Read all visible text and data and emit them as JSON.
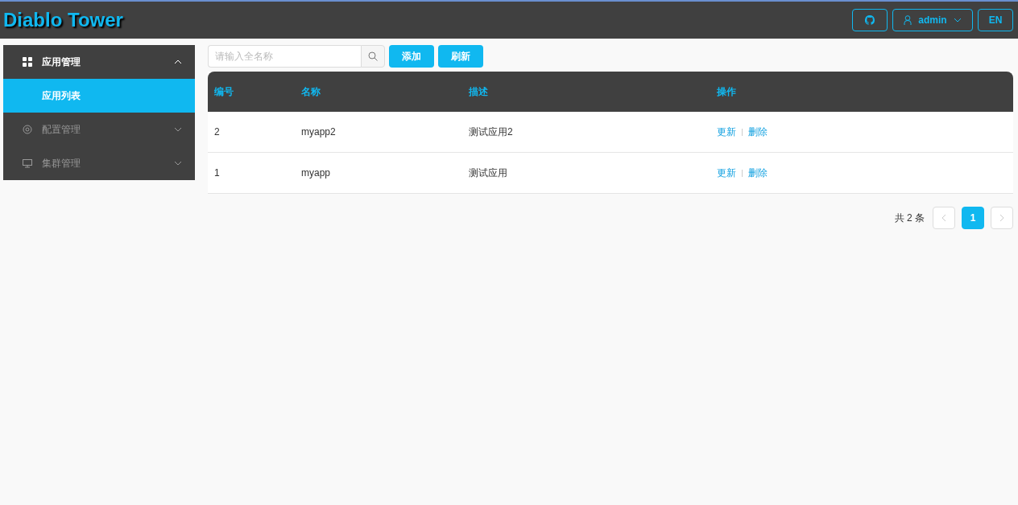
{
  "header": {
    "title": "Diablo Tower",
    "user": "admin",
    "language": "EN"
  },
  "sidebar": {
    "items": [
      {
        "label": "应用管理",
        "expanded": true,
        "children": [
          {
            "label": "应用列表",
            "selected": true
          }
        ]
      },
      {
        "label": "配置管理",
        "expanded": false
      },
      {
        "label": "集群管理",
        "expanded": false
      }
    ]
  },
  "toolbar": {
    "search": {
      "placeholder": "请输入全名称"
    },
    "buttons": [
      "添加",
      "刷新"
    ]
  },
  "table": {
    "columns": [
      "编号",
      "名称",
      "描述",
      "操作"
    ],
    "rows": [
      {
        "cells": [
          "2",
          "myapp2",
          "测试应用2"
        ],
        "actions": [
          "更新",
          "删除"
        ]
      },
      {
        "cells": [
          "1",
          "myapp",
          "测试应用"
        ],
        "actions": [
          "更新",
          "删除"
        ]
      }
    ]
  },
  "pagination": {
    "total": "共 2 条",
    "pages": [
      {
        "label": "1",
        "selected": true
      }
    ]
  }
}
